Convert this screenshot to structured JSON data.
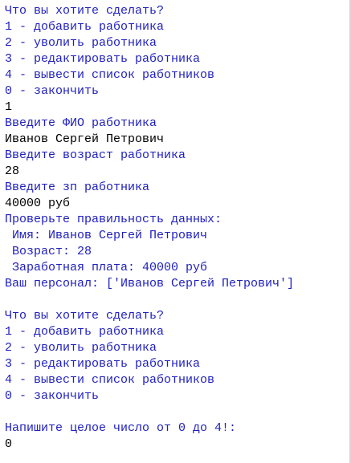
{
  "colors": {
    "output_text": "#1f1fbf",
    "input_text": "#000000",
    "background": "#ffffff"
  },
  "console": {
    "lines": [
      {
        "text": "Что вы хотите сделать?",
        "kind": "out"
      },
      {
        "text": "1 - добавить работника",
        "kind": "out"
      },
      {
        "text": "2 - уволить работника",
        "kind": "out"
      },
      {
        "text": "3 - редактировать работника",
        "kind": "out"
      },
      {
        "text": "4 - вывести список работников",
        "kind": "out"
      },
      {
        "text": "0 - закончить",
        "kind": "out"
      },
      {
        "text": "1",
        "kind": "inp"
      },
      {
        "text": "Введите ФИО работника",
        "kind": "out"
      },
      {
        "text": "Иванов Сергей Петрович",
        "kind": "inp"
      },
      {
        "text": "Введите возраст работника",
        "kind": "out"
      },
      {
        "text": "28",
        "kind": "inp"
      },
      {
        "text": "Введите зп работника",
        "kind": "out"
      },
      {
        "text": "40000 руб",
        "kind": "inp"
      },
      {
        "text": "Проверьте правильность данных:",
        "kind": "out"
      },
      {
        "text": " Имя: Иванов Сергей Петрович",
        "kind": "out"
      },
      {
        "text": " Возраст: 28",
        "kind": "out"
      },
      {
        "text": " Заработная плата: 40000 руб",
        "kind": "out"
      },
      {
        "text": "Ваш персонал: ['Иванов Сергей Петрович']",
        "kind": "out"
      },
      {
        "text": "",
        "kind": "out"
      },
      {
        "text": "Что вы хотите сделать?",
        "kind": "out"
      },
      {
        "text": "1 - добавить работника",
        "kind": "out"
      },
      {
        "text": "2 - уволить работника",
        "kind": "out"
      },
      {
        "text": "3 - редактировать работника",
        "kind": "out"
      },
      {
        "text": "4 - вывести список работников",
        "kind": "out"
      },
      {
        "text": "0 - закончить",
        "kind": "out"
      },
      {
        "text": "",
        "kind": "out"
      },
      {
        "text": "Напишите целое число от 0 до 4!:",
        "kind": "out"
      },
      {
        "text": "0",
        "kind": "inp"
      }
    ]
  }
}
